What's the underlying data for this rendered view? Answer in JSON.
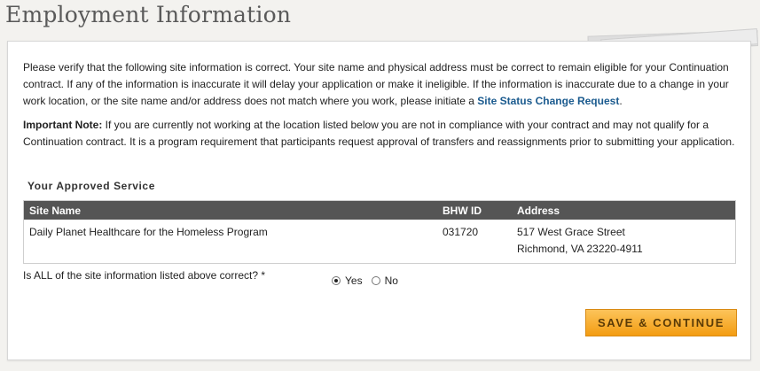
{
  "page": {
    "title": "Employment Information"
  },
  "intro": {
    "text": "Please verify that the following site information is correct. Your site name and physical address must be correct to remain eligible for your Continuation contract. If any of the information is inaccurate it will delay your application or make it ineligible. If the information is inaccurate due to a change in your work location, or the site name and/or address does not match where you work, please initiate a ",
    "link_label": "Site Status Change Request",
    "suffix": "."
  },
  "note": {
    "label": "Important Note:",
    "text": " If you are currently not working at the location listed below you are not in compliance with your contract and may not qualify for a Continuation contract. It is a program requirement that participants request approval of transfers and reassignments prior to submitting your application."
  },
  "service": {
    "section_title": "Your Approved Service",
    "columns": [
      "Site Name",
      "BHW ID",
      "Address"
    ],
    "rows": [
      {
        "site_name": "Daily Planet Healthcare for the Homeless Program",
        "bhw_id": "031720",
        "address_line1": "517 West Grace Street",
        "address_line2": "Richmond, VA 23220-4911"
      }
    ]
  },
  "confirm": {
    "question": "Is ALL of the site information listed above correct? *",
    "options": [
      "Yes",
      "No"
    ],
    "selected": "Yes"
  },
  "actions": {
    "save_label": "SAVE & CONTINUE"
  },
  "colors": {
    "table_header": "#555555",
    "link": "#1a5a8e",
    "button": "#f5a623"
  }
}
